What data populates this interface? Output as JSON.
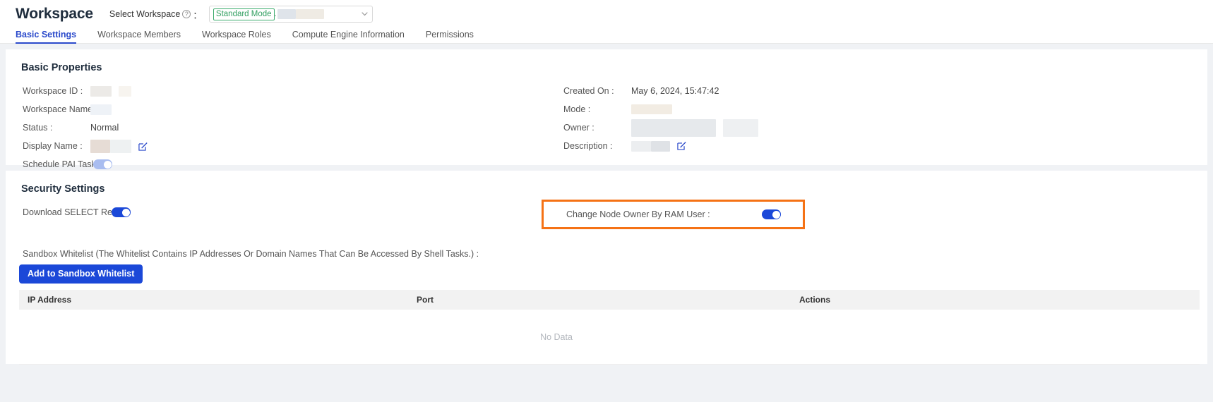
{
  "header": {
    "title": "Workspace",
    "select_workspace_label": "Select Workspace",
    "help_icon_glyph": "?",
    "colon": "：",
    "workspace_select": {
      "mode_tag": "Standard Mode",
      "separator": ".",
      "chevron_icon": "chevron-down-icon"
    },
    "tabs": [
      {
        "label": "Basic Settings",
        "active": true
      },
      {
        "label": "Workspace Members",
        "active": false
      },
      {
        "label": "Workspace Roles",
        "active": false
      },
      {
        "label": "Compute Engine Information",
        "active": false
      },
      {
        "label": "Permissions",
        "active": false
      }
    ]
  },
  "basic_properties": {
    "title": "Basic Properties",
    "left": [
      {
        "label": "Workspace ID :",
        "value": "",
        "redacted": true
      },
      {
        "label": "Workspace Name :",
        "value": "",
        "redacted": true
      },
      {
        "label": "Status :",
        "value": "Normal",
        "redacted": false
      },
      {
        "label": "Display Name :",
        "value": "",
        "redacted": true,
        "edit": true
      },
      {
        "label": "Schedule PAI Tasks :",
        "value": "",
        "toggle": "on-faded"
      }
    ],
    "right": [
      {
        "label": "Created On :",
        "value": "May 6, 2024, 15:47:42",
        "redacted": false
      },
      {
        "label": "Mode :",
        "value": "",
        "redacted": true
      },
      {
        "label": "Owner :",
        "value": "",
        "redacted": true
      },
      {
        "label": "Description :",
        "value": "",
        "redacted": true,
        "edit": true
      }
    ]
  },
  "security_settings": {
    "title": "Security Settings",
    "download_select_result_label": "Download SELECT Result :",
    "download_select_result_state": "on",
    "change_node_owner_label": "Change Node Owner By RAM User :",
    "change_node_owner_state": "on",
    "highlight_color": "#f57215",
    "whitelist_note": "Sandbox Whitelist (The Whitelist Contains IP Addresses Or Domain Names That Can Be Accessed By Shell Tasks.) :",
    "add_button_label": "Add to Sandbox Whitelist",
    "table": {
      "columns": [
        "IP Address",
        "Port",
        "Actions"
      ],
      "rows": [],
      "empty_text": "No Data"
    }
  },
  "colors": {
    "primary_blue": "#1b48d8",
    "tab_active": "#2b4acb",
    "tag_green": "#2f9e5f",
    "highlight_orange": "#f57215"
  }
}
